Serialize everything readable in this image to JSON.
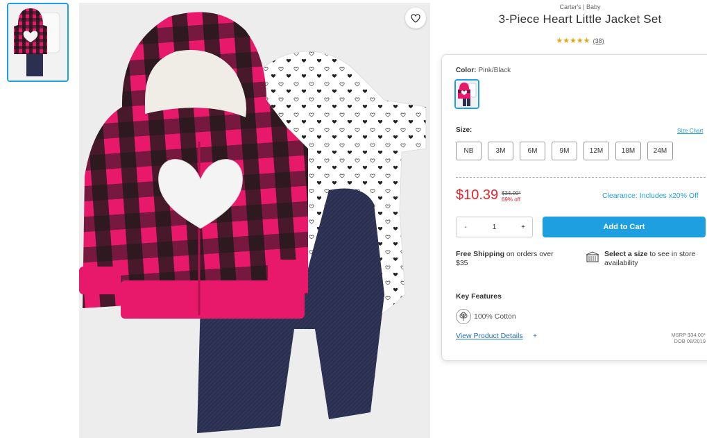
{
  "product": {
    "brand": "Carter's | Baby",
    "title": "3-Piece Heart Little Jacket Set",
    "stars": "★★★★★",
    "review_count": "(38)",
    "rating_value": 5
  },
  "color": {
    "label": "Color:",
    "value": "Pink/Black"
  },
  "size": {
    "label": "Size:",
    "chart_link": "Size Chart",
    "options": [
      "NB",
      "3M",
      "6M",
      "9M",
      "12M",
      "18M",
      "24M"
    ]
  },
  "price": {
    "current": "$10.39",
    "original": "$34.00*",
    "percent_off": "69% off",
    "clearance_note": "Clearance: Includes x20% Off"
  },
  "cart": {
    "qty_minus": "-",
    "qty_value": "1",
    "qty_plus": "+",
    "add_label": "Add to Cart"
  },
  "shipping": {
    "bold": "Free Shipping",
    "text": " on orders over $35"
  },
  "store": {
    "bold": "Select a size",
    "text": " to see in store availability"
  },
  "features": {
    "title": "Key Features",
    "items": [
      "100% Cotton"
    ],
    "details_link": "View Product Details",
    "details_plus": "+",
    "msrp": "MSRP $34.00*",
    "dob": "DOB 08/2019"
  },
  "colors": {
    "accent": "#1ea0e0",
    "price_red": "#e3232c",
    "star": "#e8a317",
    "plaid_pink": "#e8196b",
    "plaid_black": "#1a1a1a",
    "denim": "#2c3050"
  },
  "icons": {
    "favorite": "heart-outline-icon",
    "store": "store-icon",
    "cotton": "cotton-icon"
  }
}
